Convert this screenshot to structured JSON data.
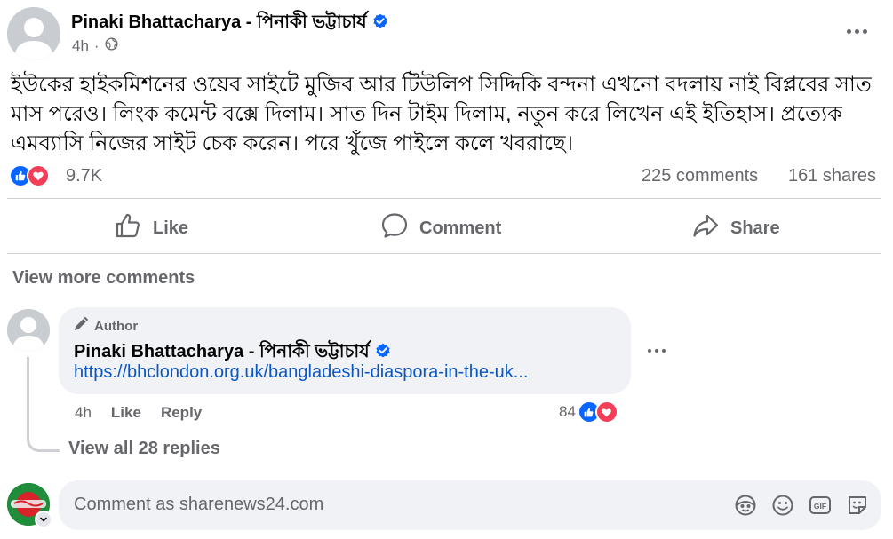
{
  "post": {
    "author_name": "Pinaki Bhattacharya - পিনাকী ভট্টাচার্য",
    "time": "4h",
    "body": "ইউকের হাইকমিশনের ওয়েব সাইটে মুজিব আর টিউলিপ সিদ্দিকি বন্দনা এখনো বদলায় নাই বিপ্লবের সাত মাস পরেও। লিংক কমেন্ট বক্সে দিলাম। সাত দিন টাইম দিলাম, নতুন করে লিখেন এই ইতিহাস। প্রত্যেক এমব্যাসি নিজের সাইট চেক করেন। পরে খুঁজে পাইলে কলে খবরাছে।",
    "reactions_count": "9.7K",
    "comments_count": "225 comments",
    "shares_count": "161 shares",
    "reaction_icons": [
      "like-icon",
      "love-icon"
    ]
  },
  "actions": {
    "like": "Like",
    "comment": "Comment",
    "share": "Share"
  },
  "comments": {
    "view_more": "View more comments",
    "items": [
      {
        "badge": "Author",
        "author_name": "Pinaki Bhattacharya - পিনাকী ভট্টাচার্য",
        "link_text": "https://bhclondon.org.uk/bangladeshi-diaspora-in-the-uk...",
        "time": "4h",
        "like": "Like",
        "reply": "Reply",
        "reactions_count": "84"
      }
    ],
    "view_replies": "View all 28 replies"
  },
  "composer": {
    "placeholder": "Comment as sharenews24.com",
    "icons": [
      "avatar-sticker-icon",
      "emoji-icon",
      "gif-icon",
      "sticker-icon"
    ]
  },
  "colors": {
    "like_blue": "#0866ff",
    "love_red": "#f33e58",
    "secondary_text": "#65676b",
    "link": "#0a56c2",
    "bubble_bg": "#f0f2f5"
  }
}
